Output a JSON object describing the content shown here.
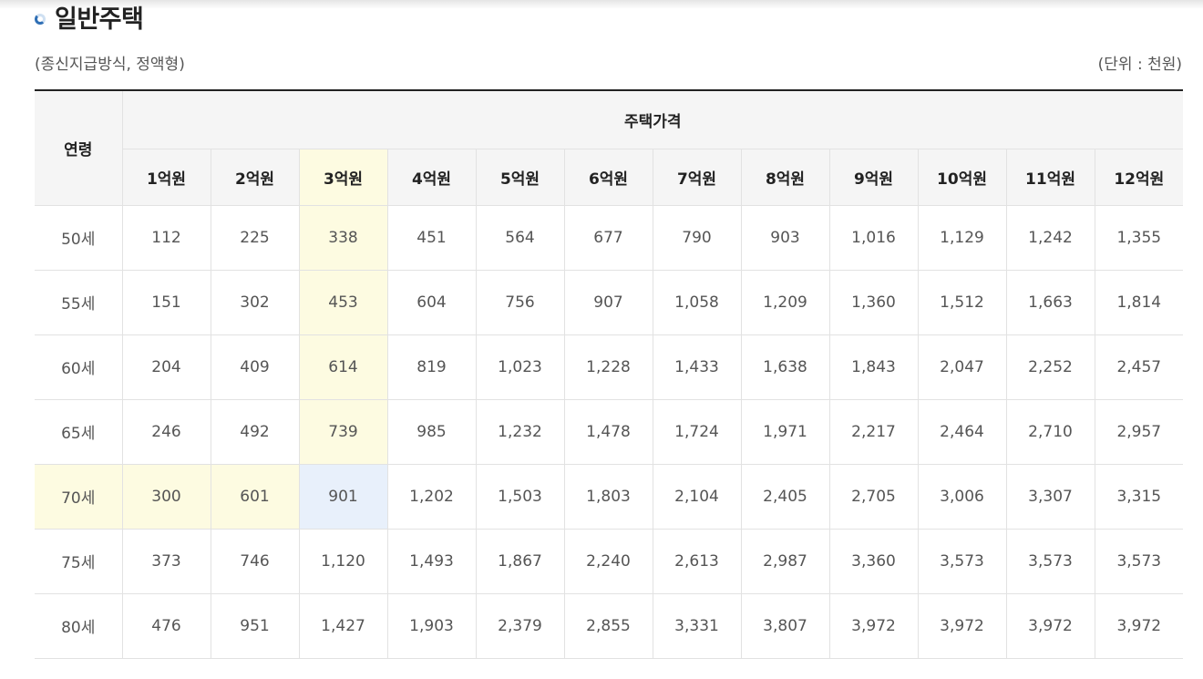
{
  "title": "일반주택",
  "subtitle": "(종신지급방식, 정액형)",
  "unit": "(단위 : 천원)",
  "colors": {
    "highlight_yellow": "#fdfbe1",
    "highlight_blue": "#e8f0fb",
    "header_bg": "#f5f5f5"
  },
  "table": {
    "age_header": "연령",
    "price_header": "주택가격",
    "price_columns": [
      "1억원",
      "2억원",
      "3억원",
      "4억원",
      "5억원",
      "6억원",
      "7억원",
      "8억원",
      "9억원",
      "10억원",
      "11억원",
      "12억원"
    ],
    "rows": [
      {
        "age": "50세",
        "values": [
          "112",
          "225",
          "338",
          "451",
          "564",
          "677",
          "790",
          "903",
          "1,016",
          "1,129",
          "1,242",
          "1,355"
        ]
      },
      {
        "age": "55세",
        "values": [
          "151",
          "302",
          "453",
          "604",
          "756",
          "907",
          "1,058",
          "1,209",
          "1,360",
          "1,512",
          "1,663",
          "1,814"
        ]
      },
      {
        "age": "60세",
        "values": [
          "204",
          "409",
          "614",
          "819",
          "1,023",
          "1,228",
          "1,433",
          "1,638",
          "1,843",
          "2,047",
          "2,252",
          "2,457"
        ]
      },
      {
        "age": "65세",
        "values": [
          "246",
          "492",
          "739",
          "985",
          "1,232",
          "1,478",
          "1,724",
          "1,971",
          "2,217",
          "2,464",
          "2,710",
          "2,957"
        ]
      },
      {
        "age": "70세",
        "values": [
          "300",
          "601",
          "901",
          "1,202",
          "1,503",
          "1,803",
          "2,104",
          "2,405",
          "2,705",
          "3,006",
          "3,307",
          "3,315"
        ]
      },
      {
        "age": "75세",
        "values": [
          "373",
          "746",
          "1,120",
          "1,493",
          "1,867",
          "2,240",
          "2,613",
          "2,987",
          "3,360",
          "3,573",
          "3,573",
          "3,573"
        ]
      },
      {
        "age": "80세",
        "values": [
          "476",
          "951",
          "1,427",
          "1,903",
          "2,379",
          "2,855",
          "3,331",
          "3,807",
          "3,972",
          "3,972",
          "3,972",
          "3,972"
        ]
      }
    ]
  }
}
